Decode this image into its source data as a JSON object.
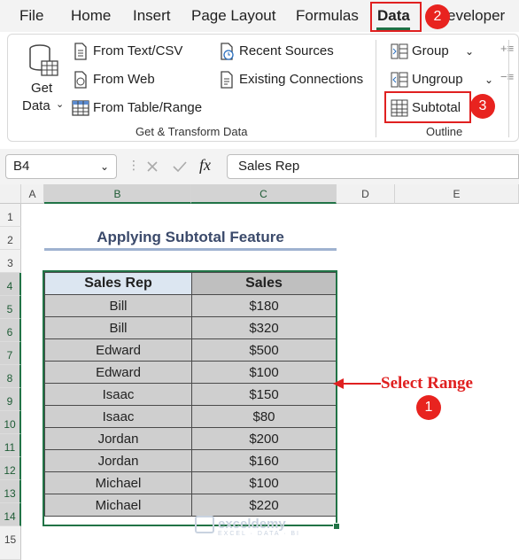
{
  "menu": {
    "items": [
      "File",
      "Home",
      "Insert",
      "Page Layout",
      "Formulas",
      "Data",
      "eveloper"
    ],
    "active": "Data"
  },
  "badges": [
    "1",
    "2",
    "3"
  ],
  "ribbon": {
    "get_data_line1": "Get",
    "get_data_line2": "Data",
    "from_text_csv": "From Text/CSV",
    "from_web": "From Web",
    "from_table_range": "From Table/Range",
    "recent_sources": "Recent Sources",
    "existing_connections": "Existing Connections",
    "group_label_get_transform": "Get & Transform Data",
    "group": "Group",
    "ungroup": "Ungroup",
    "subtotal": "Subtotal",
    "group_label_outline": "Outline"
  },
  "formula_bar": {
    "name_box": "B4",
    "fx": "fx",
    "content": "Sales Rep"
  },
  "columns": [
    "A",
    "B",
    "C",
    "D",
    "E"
  ],
  "rows": [
    "1",
    "2",
    "3",
    "4",
    "5",
    "6",
    "7",
    "8",
    "9",
    "10",
    "11",
    "12",
    "13",
    "14",
    "15"
  ],
  "sheet": {
    "title": "Applying Subtotal Feature",
    "headers": [
      "Sales Rep",
      "Sales"
    ],
    "data": [
      [
        "Bill",
        "$180"
      ],
      [
        "Bill",
        "$320"
      ],
      [
        "Edward",
        "$500"
      ],
      [
        "Edward",
        "$100"
      ],
      [
        "Isaac",
        "$150"
      ],
      [
        "Isaac",
        "$80"
      ],
      [
        "Jordan",
        "$200"
      ],
      [
        "Jordan",
        "$160"
      ],
      [
        "Michael",
        "$100"
      ],
      [
        "Michael",
        "$220"
      ]
    ]
  },
  "annotation": "Select Range",
  "watermark": {
    "name": "exceldemy",
    "tagline": "EXCEL · DATA · BI"
  },
  "colors": {
    "accent_green": "#217346",
    "annotation_red": "#e02020",
    "header_blue": "#dce6f1",
    "header_gray": "#bfbfbf",
    "cell_gray": "#cfcfcf"
  }
}
